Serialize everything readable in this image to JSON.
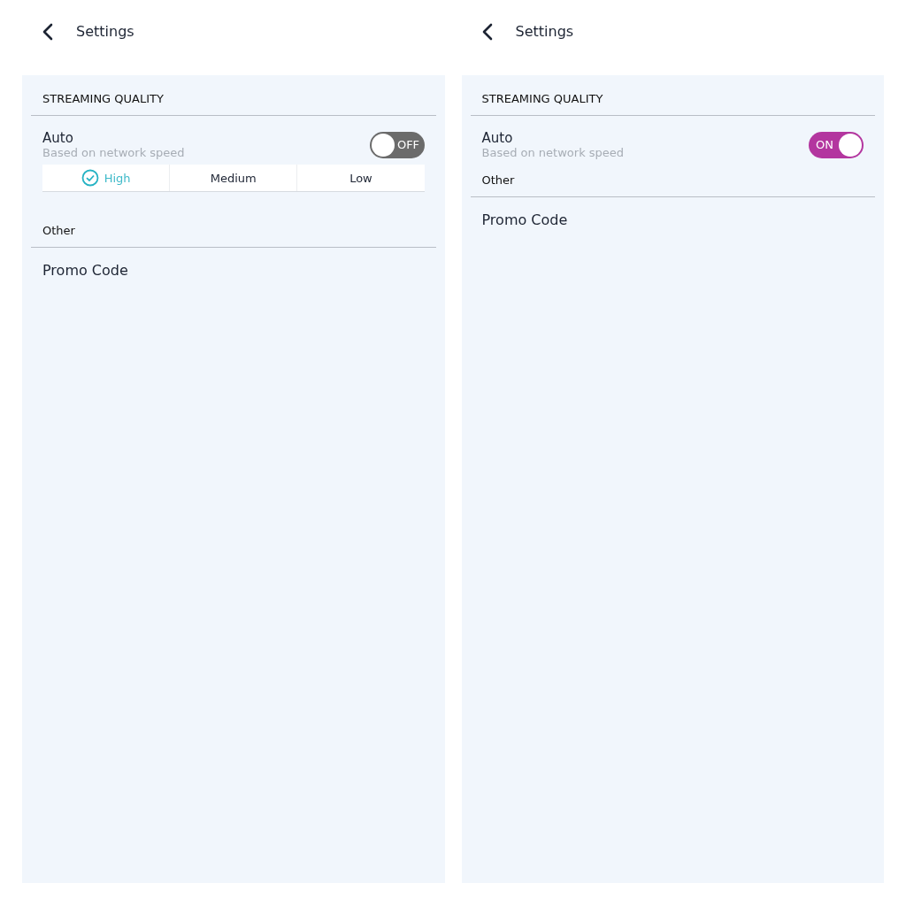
{
  "screens": [
    {
      "title": "Settings",
      "section": "STREAMING QUALITY",
      "auto": {
        "label": "Auto",
        "sublabel": "Based on network speed",
        "on": false,
        "toggle_text": "OFF"
      },
      "qualities": [
        {
          "label": "High",
          "selected": true
        },
        {
          "label": "Medium",
          "selected": false
        },
        {
          "label": "Low",
          "selected": false
        }
      ],
      "other": "Other",
      "promo": "Promo Code"
    },
    {
      "title": "Settings",
      "section": "STREAMING QUALITY",
      "auto": {
        "label": "Auto",
        "sublabel": "Based on network speed",
        "on": true,
        "toggle_text": "ON"
      },
      "other": "Other",
      "promo": "Promo Code"
    }
  ]
}
